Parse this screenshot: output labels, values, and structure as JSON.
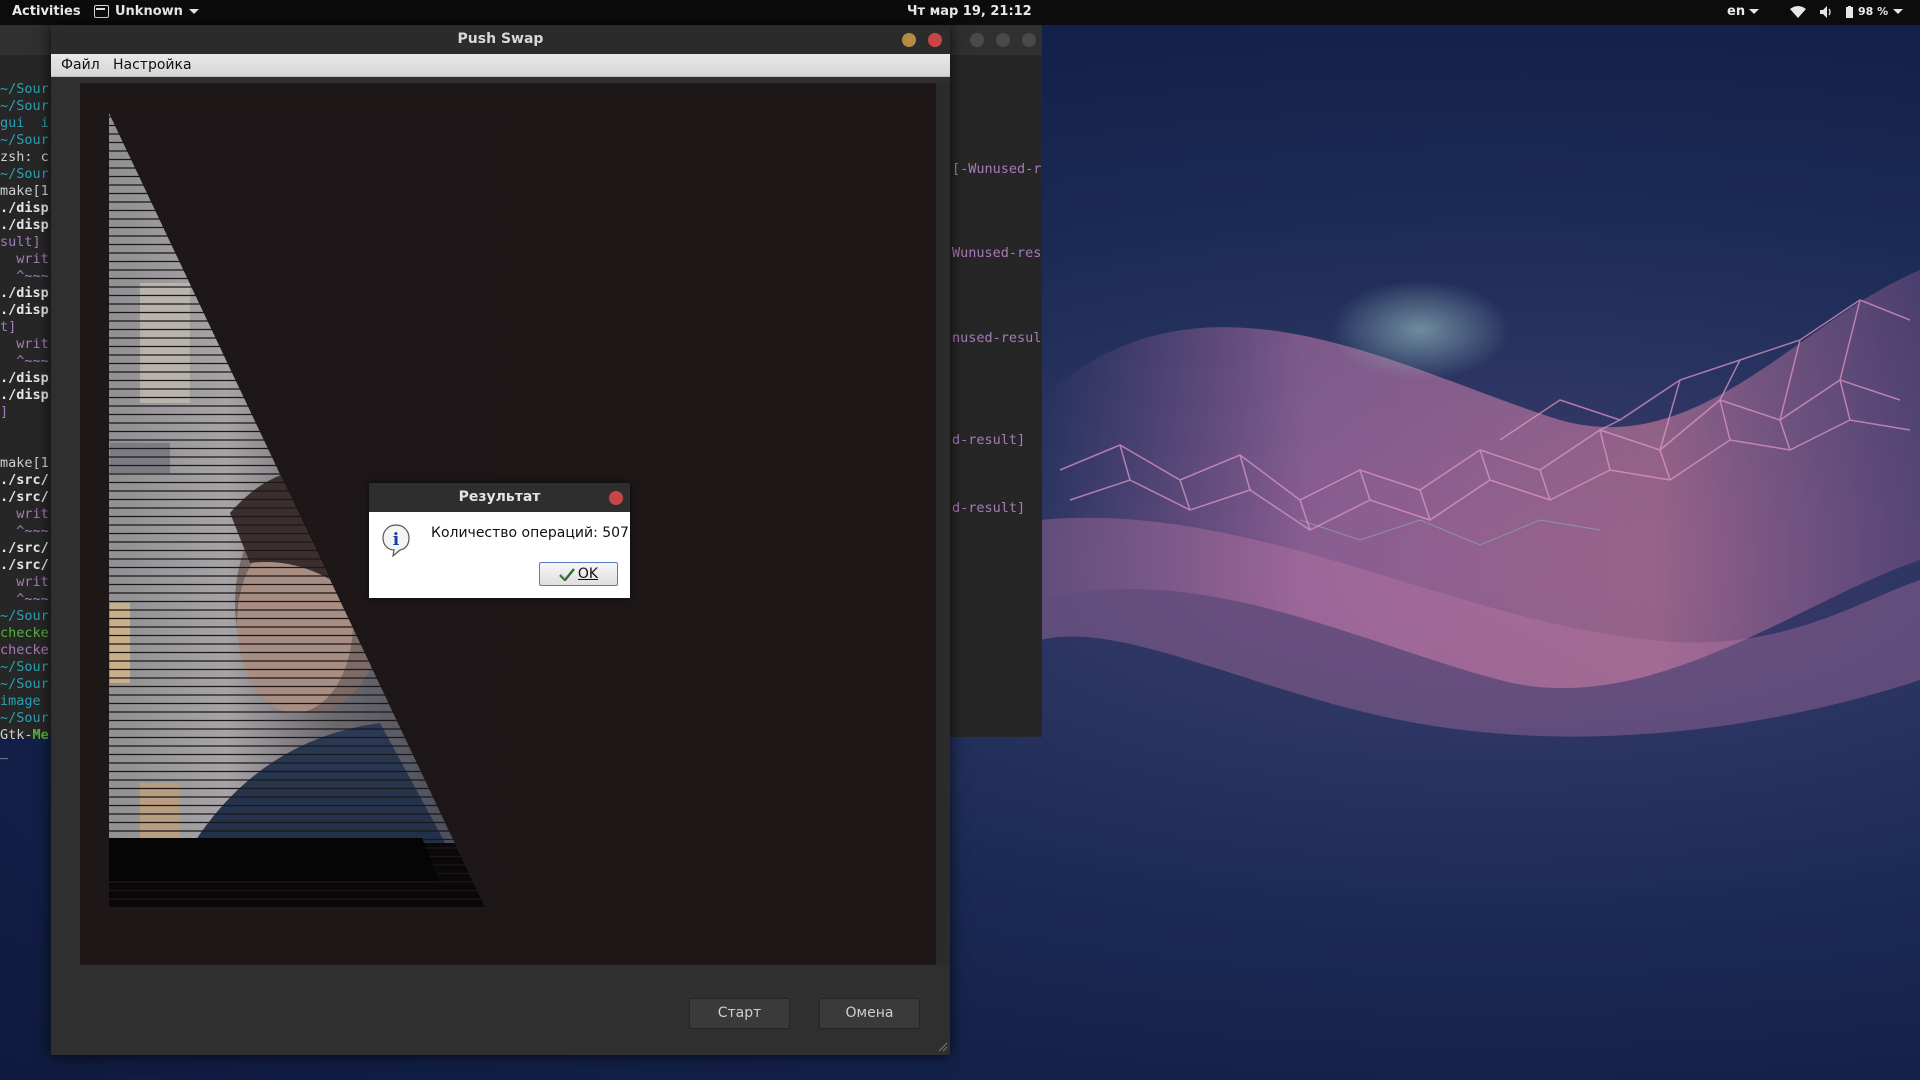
{
  "topbar": {
    "activities": "Activities",
    "app_name": "Unknown",
    "clock": "Чт мар 19, 21:12",
    "language": "en",
    "battery": "98 %"
  },
  "terminal": {
    "left_lines": [
      {
        "text": "~/Sour",
        "color": "cyan"
      },
      {
        "text": "~/Sour",
        "color": "cyan"
      },
      {
        "text": "gui  i",
        "color": "cyan"
      },
      {
        "text": "~/Sour",
        "color": "cyan"
      },
      {
        "text": "zsh: c",
        "color": "dim"
      },
      {
        "text": "~/Sour",
        "color": "cyan"
      },
      {
        "text": "make[1",
        "color": "dim"
      },
      {
        "text": "./disp",
        "color": "white"
      },
      {
        "text": "./disp",
        "color": "white"
      },
      {
        "text": "sult]",
        "color": "purple"
      },
      {
        "text": "  writ",
        "color": "purple"
      },
      {
        "text": "  ^~~~",
        "color": "purple"
      },
      {
        "text": "./disp",
        "color": "white"
      },
      {
        "text": "./disp",
        "color": "white"
      },
      {
        "text": "t]",
        "color": "purple"
      },
      {
        "text": "  writ",
        "color": "purple"
      },
      {
        "text": "  ^~~~",
        "color": "purple"
      },
      {
        "text": "./disp",
        "color": "white"
      },
      {
        "text": "./disp",
        "color": "white"
      },
      {
        "text": "]",
        "color": "purple"
      },
      {
        "text": "",
        "color": "dim"
      },
      {
        "text": "",
        "color": "dim"
      },
      {
        "text": "make[1",
        "color": "dim"
      },
      {
        "text": "./src/",
        "color": "white"
      },
      {
        "text": "./src/",
        "color": "white"
      },
      {
        "text": "  writ",
        "color": "purple"
      },
      {
        "text": "  ^~~~",
        "color": "purple"
      },
      {
        "text": "./src/",
        "color": "white"
      },
      {
        "text": "./src/",
        "color": "white"
      },
      {
        "text": "  writ",
        "color": "purple"
      },
      {
        "text": "  ^~~~",
        "color": "purple"
      },
      {
        "text": "~/Sour",
        "color": "cyan"
      },
      {
        "text": "checke",
        "color": "green"
      },
      {
        "text": "checke",
        "color": "purple"
      },
      {
        "text": "~/Sour",
        "color": "cyan"
      },
      {
        "text": "~/Sour",
        "color": "cyan"
      },
      {
        "text": "image",
        "color": "cyan"
      },
      {
        "text": "~/Sour",
        "color": "cyan"
      },
      {
        "text": "Gtk-Me",
        "color": "mixed"
      },
      {
        "text": "_",
        "color": "dim"
      }
    ],
    "right_lines": [
      "[-Wunused-re",
      "Wunused-resul",
      "nused-result",
      "d-result]",
      "d-result]"
    ]
  },
  "window": {
    "title": "Push Swap",
    "menu": {
      "file": "Файл",
      "settings": "Настройка"
    },
    "buttons": {
      "start": "Старт",
      "cancel": "Омена"
    }
  },
  "dialog": {
    "title": "Результат",
    "message": "Количество операций: 507",
    "ok": "OK",
    "icon": "info-icon"
  },
  "colors": {
    "terminal_bg": "#262626",
    "canvas_bg": "#1d1718",
    "close": "#c94545",
    "minimize": "#b58a45"
  }
}
